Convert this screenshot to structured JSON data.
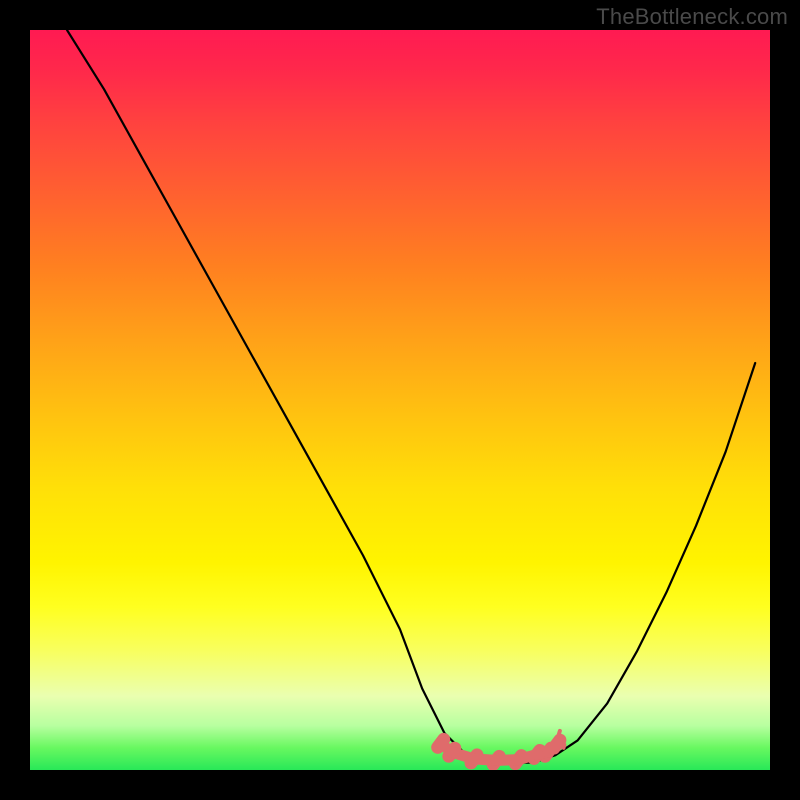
{
  "watermark": "TheBottleneck.com",
  "chart_data": {
    "type": "line",
    "title": "",
    "xlabel": "",
    "ylabel": "",
    "xlim": [
      0,
      100
    ],
    "ylim": [
      0,
      100
    ],
    "grid": false,
    "series": [
      {
        "name": "curve",
        "x": [
          5,
          10,
          15,
          20,
          25,
          30,
          35,
          40,
          45,
          50,
          53,
          56,
          59,
          62,
          65,
          68,
          71,
          74,
          78,
          82,
          86,
          90,
          94,
          98
        ],
        "y": [
          100,
          92,
          83,
          74,
          65,
          56,
          47,
          38,
          29,
          19,
          11,
          5,
          2,
          1,
          1,
          1,
          2,
          4,
          9,
          16,
          24,
          33,
          43,
          55
        ]
      }
    ],
    "marks": {
      "name": "highlight",
      "color": "#df6b6b",
      "points": [
        {
          "x": 55.5,
          "y": 3.6
        },
        {
          "x": 57.0,
          "y": 2.4
        },
        {
          "x": 60.0,
          "y": 1.5
        },
        {
          "x": 63.0,
          "y": 1.3
        },
        {
          "x": 66.0,
          "y": 1.4
        },
        {
          "x": 68.5,
          "y": 2.1
        },
        {
          "x": 70.0,
          "y": 2.4
        },
        {
          "x": 71.2,
          "y": 3.5
        }
      ]
    },
    "background_gradient": {
      "top": "#ff1a52",
      "mid": "#ffe000",
      "bottom": "#28e858"
    }
  }
}
